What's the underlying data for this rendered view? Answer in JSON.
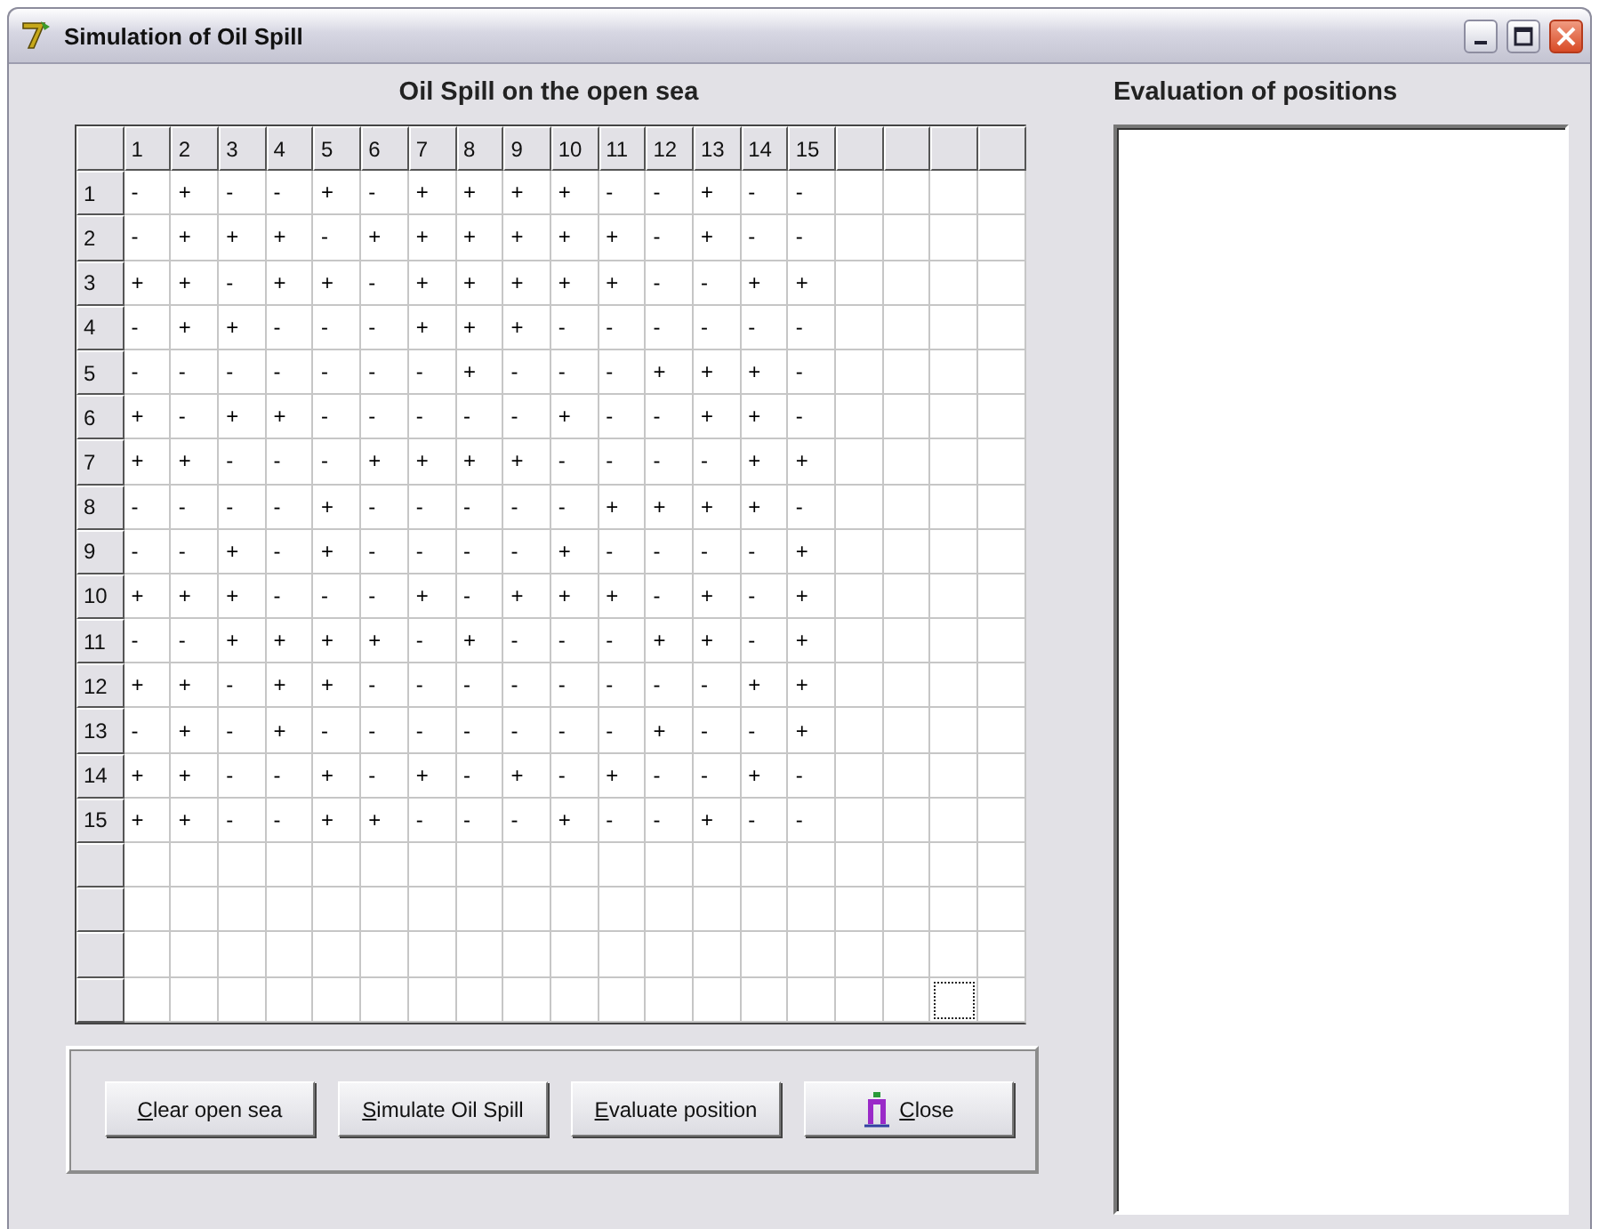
{
  "window": {
    "title": "Simulation of Oil Spill"
  },
  "sea": {
    "title": "Oil Spill on the open sea",
    "columns": [
      "1",
      "2",
      "3",
      "4",
      "5",
      "6",
      "7",
      "8",
      "9",
      "10",
      "11",
      "12",
      "13",
      "14",
      "15"
    ],
    "blank_columns": [
      {
        "focus": false
      },
      {
        "focus": false
      },
      {
        "focus": true
      },
      {
        "focus": false
      }
    ],
    "rows": [
      {
        "header": "1",
        "cells": [
          "-",
          "+",
          "-",
          "-",
          "+",
          "-",
          "+",
          "+",
          "+",
          "+",
          "-",
          "-",
          "+",
          "-",
          "-"
        ]
      },
      {
        "header": "2",
        "cells": [
          "-",
          "+",
          "+",
          "+",
          "-",
          "+",
          "+",
          "+",
          "+",
          "+",
          "+",
          "-",
          "+",
          "-",
          "-"
        ]
      },
      {
        "header": "3",
        "cells": [
          "+",
          "+",
          "-",
          "+",
          "+",
          "-",
          "+",
          "+",
          "+",
          "+",
          "+",
          "-",
          "-",
          "+",
          "+"
        ]
      },
      {
        "header": "4",
        "cells": [
          "-",
          "+",
          "+",
          "-",
          "-",
          "-",
          "+",
          "+",
          "+",
          "-",
          "-",
          "-",
          "-",
          "-",
          "-"
        ]
      },
      {
        "header": "5",
        "cells": [
          "-",
          "-",
          "-",
          "-",
          "-",
          "-",
          "-",
          "+",
          "-",
          "-",
          "-",
          "+",
          "+",
          "+",
          "-"
        ]
      },
      {
        "header": "6",
        "cells": [
          "+",
          "-",
          "+",
          "+",
          "-",
          "-",
          "-",
          "-",
          "-",
          "+",
          "-",
          "-",
          "+",
          "+",
          "-"
        ]
      },
      {
        "header": "7",
        "cells": [
          "+",
          "+",
          "-",
          "-",
          "-",
          "+",
          "+",
          "+",
          "+",
          "-",
          "-",
          "-",
          "-",
          "+",
          "+"
        ]
      },
      {
        "header": "8",
        "cells": [
          "-",
          "-",
          "-",
          "-",
          "+",
          "-",
          "-",
          "-",
          "-",
          "-",
          "+",
          "+",
          "+",
          "+",
          "-"
        ]
      },
      {
        "header": "9",
        "cells": [
          "-",
          "-",
          "+",
          "-",
          "+",
          "-",
          "-",
          "-",
          "-",
          "+",
          "-",
          "-",
          "-",
          "-",
          "+"
        ]
      },
      {
        "header": "10",
        "cells": [
          "+",
          "+",
          "+",
          "-",
          "-",
          "-",
          "+",
          "-",
          "+",
          "+",
          "+",
          "-",
          "+",
          "-",
          "+"
        ]
      },
      {
        "header": "11",
        "cells": [
          "-",
          "-",
          "+",
          "+",
          "+",
          "+",
          "-",
          "+",
          "-",
          "-",
          "-",
          "+",
          "+",
          "-",
          "+"
        ]
      },
      {
        "header": "12",
        "cells": [
          "+",
          "+",
          "-",
          "+",
          "+",
          "-",
          "-",
          "-",
          "-",
          "-",
          "-",
          "-",
          "-",
          "+",
          "+"
        ]
      },
      {
        "header": "13",
        "cells": [
          "-",
          "+",
          "-",
          "+",
          "-",
          "-",
          "-",
          "-",
          "-",
          "-",
          "-",
          "+",
          "-",
          "-",
          "+"
        ]
      },
      {
        "header": "14",
        "cells": [
          "+",
          "+",
          "-",
          "-",
          "+",
          "-",
          "+",
          "-",
          "+",
          "-",
          "+",
          "-",
          "-",
          "+",
          "-"
        ]
      },
      {
        "header": "15",
        "cells": [
          "+",
          "+",
          "-",
          "-",
          "+",
          "+",
          "-",
          "-",
          "-",
          "+",
          "-",
          "-",
          "+",
          "-",
          "-"
        ]
      }
    ],
    "blank_rows": [
      {
        "focus": false
      },
      {
        "focus": false
      },
      {
        "focus": false
      },
      {
        "focus": true
      }
    ]
  },
  "buttons": [
    {
      "label": "Clear open sea",
      "kind": "text"
    },
    {
      "label": "Simulate Oil Spill",
      "kind": "text"
    },
    {
      "label": "Evaluate position",
      "kind": "text"
    },
    {
      "label": "Close",
      "kind": "close"
    }
  ],
  "evaluation": {
    "title": "Evaluation of positions"
  }
}
